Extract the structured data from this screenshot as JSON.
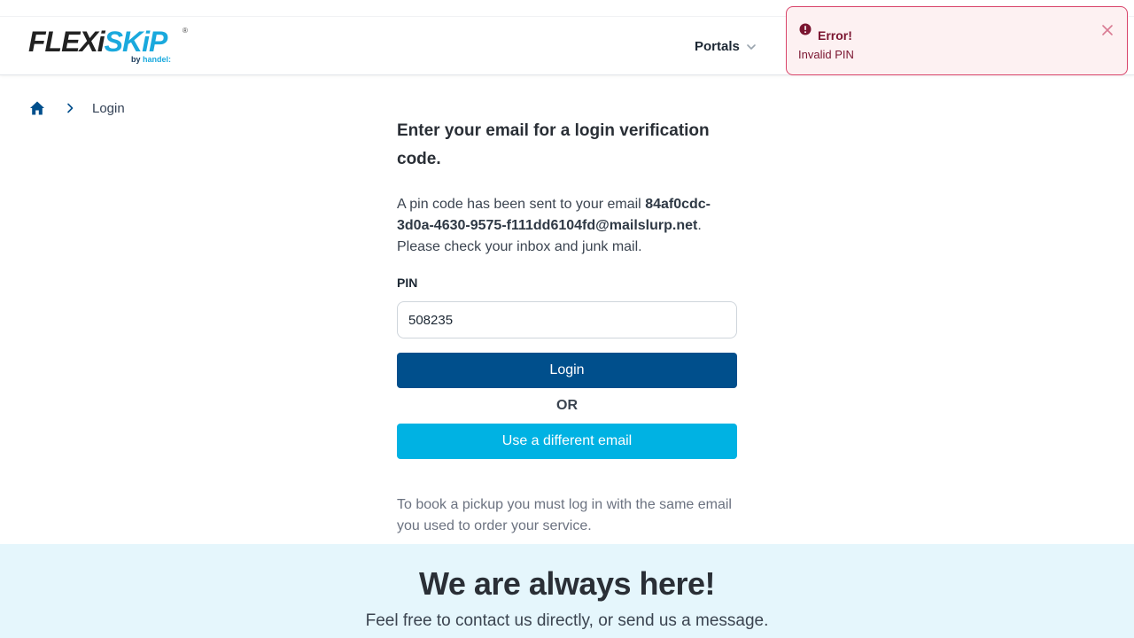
{
  "header": {
    "logo": {
      "brand_part1": "FLEXi",
      "brand_part2": "SKiP",
      "reg_mark": "®",
      "byline_prefix": "by ",
      "byline_brand": "handel:"
    },
    "nav": {
      "portals_label": "Portals"
    }
  },
  "toast": {
    "title": "Error!",
    "message": "Invalid PIN",
    "icon": "exclamation-circle-icon",
    "close_icon": "close-icon"
  },
  "breadcrumb": {
    "home_icon": "home-icon",
    "separator_icon": "chevron-right-icon",
    "current": "Login"
  },
  "main": {
    "title": "Enter your email for a login verification code.",
    "intro_prefix": "A pin code has been sent to your email ",
    "email": "84af0cdc-3d0a-4630-9575-f111dd6104fd@mailslurp.net",
    "intro_suffix": ". Please check your inbox and junk mail.",
    "pin_label": "PIN",
    "pin_value": "508235",
    "login_button": "Login",
    "or_text": "OR",
    "alt_button": "Use a different email",
    "note": "To book a pickup you must log in with the same email you used to order your service."
  },
  "footer": {
    "title": "We are always here!",
    "subtitle": "Feel free to contact us directly, or send us a message."
  },
  "colors": {
    "primary": "#004f8c",
    "accent": "#00b2e3",
    "error_border": "#d9446a",
    "error_bg": "#fdf1f2",
    "footer_bg": "#e5f6fc"
  }
}
